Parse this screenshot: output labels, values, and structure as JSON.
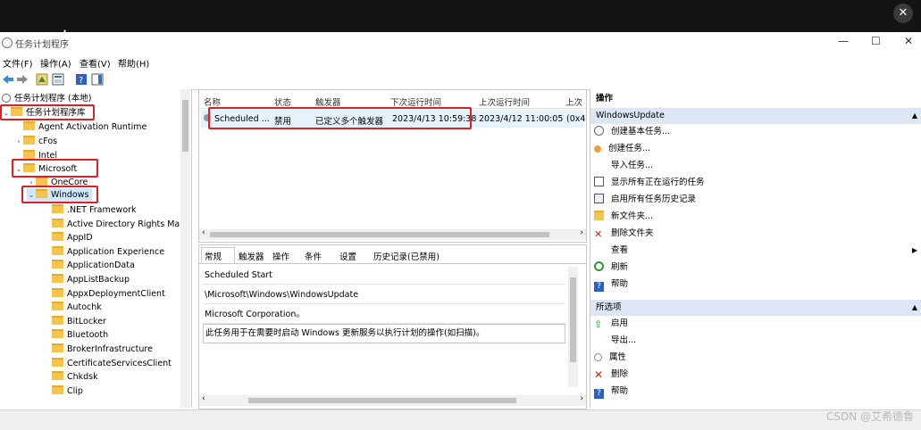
{
  "window": {
    "title": "任务计划程序",
    "controls": {
      "min": "—",
      "max": "☐",
      "close": "✕"
    }
  },
  "overlay_close": "✕",
  "menu": [
    "文件(F)",
    "操作(A)",
    "查看(V)",
    "帮助(H)"
  ],
  "tree": {
    "root": "任务计划程序 (本地)",
    "library": "任务计划程序库",
    "items": [
      "Agent Activation Runtime",
      "cFos",
      "Intel",
      "Microsoft",
      "OneCore",
      "Windows"
    ],
    "windows_children": [
      ".NET Framework",
      "Active Directory Rights Mar",
      "AppID",
      "Application Experience",
      "ApplicationData",
      "AppListBackup",
      "AppxDeploymentClient",
      "Autochk",
      "BitLocker",
      "Bluetooth",
      "BrokerInfrastructure",
      "CertificateServicesClient",
      "Chkdsk",
      "Clip"
    ]
  },
  "tasklist": {
    "columns": [
      "名称",
      "状态",
      "触发器",
      "下次运行时间",
      "上次运行时间",
      "上次"
    ],
    "row": [
      "Scheduled ...",
      "禁用",
      "已定义多个触发器",
      "2023/4/13 10:59:38",
      "2023/4/12 11:00:05",
      "(0x4"
    ]
  },
  "detail": {
    "tabs": [
      "常规",
      "触发器",
      "操作",
      "条件",
      "设置",
      "历史记录(已禁用)"
    ],
    "fields": [
      "Scheduled Start",
      "\\Microsoft\\Windows\\WindowsUpdate",
      "Microsoft Corporation。",
      "此任务用于在需要时启动 Windows 更新服务以执行计划的操作(如扫描)。"
    ]
  },
  "actions": {
    "header": "操作",
    "section1": "WindowsUpdate",
    "items1": [
      "创建基本任务...",
      "创建任务...",
      "导入任务...",
      "显示所有正在运行的任务",
      "启用所有任务历史记录",
      "新文件夹...",
      "删除文件夹",
      "查看",
      "刷新",
      "帮助"
    ],
    "section2": "所选项",
    "items2": [
      "启用",
      "导出...",
      "属性",
      "删除",
      "帮助"
    ]
  },
  "watermark": "CSDN @艾希德鲁",
  "colors": {
    "highlight": "#e02020",
    "selected_bg": "#cde8ff",
    "section_bg": "#dce6f4"
  }
}
